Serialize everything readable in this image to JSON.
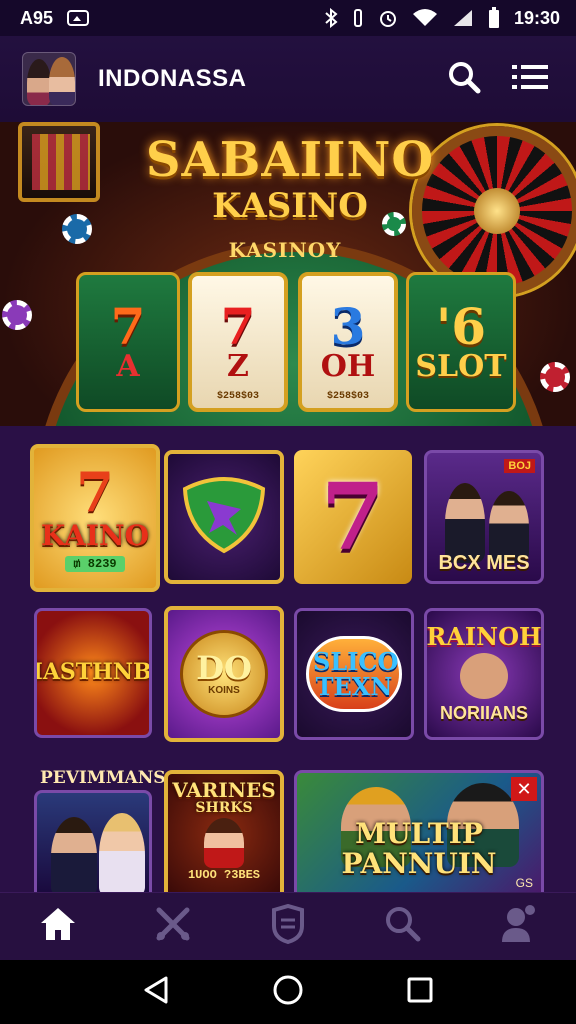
{
  "status_bar": {
    "left_text": "A95",
    "time": "19:30"
  },
  "header": {
    "title": "INDONASSA"
  },
  "hero": {
    "title": "SABAIINO",
    "subtitle": "KASINO",
    "banner": "KASINOY",
    "reels": [
      {
        "top": "7",
        "bottom": "A",
        "footer": ""
      },
      {
        "top": "7",
        "bottom": "Z",
        "footer": "$258$03"
      },
      {
        "top": "3",
        "bottom": "OH",
        "footer": "$258$03"
      },
      {
        "top": "'6",
        "bottom": "SLOT",
        "footer": ""
      }
    ]
  },
  "grid": {
    "row1": [
      {
        "label": "KAINO",
        "top": "7",
        "small": "₥ 8239"
      },
      {
        "label": ""
      },
      {
        "label": "7"
      },
      {
        "label": "BCX MES",
        "badge": "BOJ"
      }
    ],
    "row2": [
      {
        "label": "MASTHNBS"
      },
      {
        "label": "DO",
        "sub": "KOINS"
      },
      {
        "label": "SLICO TEXN"
      },
      {
        "label": "RAINOH",
        "sub": "NORIIANS"
      }
    ],
    "row3": [
      {
        "label": "PEVIMMANS"
      },
      {
        "label": "VARINES",
        "sub": "SHRKS",
        "foot": "1UOO ?3BES"
      },
      {
        "label": "MULTIP PANNUIN",
        "foot": "GS"
      }
    ]
  },
  "colors": {
    "background": "#1a0a2e",
    "header": "#23103f",
    "gold": "#ffcf4a",
    "nav": "#271040"
  }
}
